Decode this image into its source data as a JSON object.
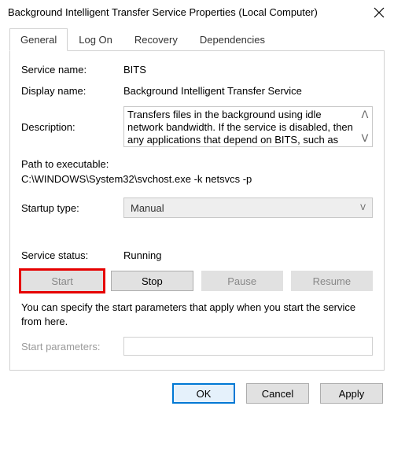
{
  "window": {
    "title": "Background Intelligent Transfer Service Properties (Local Computer)"
  },
  "tabs": {
    "general": "General",
    "logon": "Log On",
    "recovery": "Recovery",
    "dependencies": "Dependencies"
  },
  "labels": {
    "service_name": "Service name:",
    "display_name": "Display name:",
    "description": "Description:",
    "path": "Path to executable:",
    "startup_type": "Startup type:",
    "service_status": "Service status:",
    "start_parameters": "Start parameters:"
  },
  "values": {
    "service_name": "BITS",
    "display_name": "Background Intelligent Transfer Service",
    "description": "Transfers files in the background using idle network bandwidth. If the service is disabled, then any applications that depend on BITS, such as Windows",
    "path": "C:\\WINDOWS\\System32\\svchost.exe -k netsvcs -p",
    "startup_type": "Manual",
    "service_status": "Running",
    "start_parameters": ""
  },
  "buttons": {
    "start": "Start",
    "stop": "Stop",
    "pause": "Pause",
    "resume": "Resume",
    "ok": "OK",
    "cancel": "Cancel",
    "apply": "Apply"
  },
  "helptext": "You can specify the start parameters that apply when you start the service from here."
}
